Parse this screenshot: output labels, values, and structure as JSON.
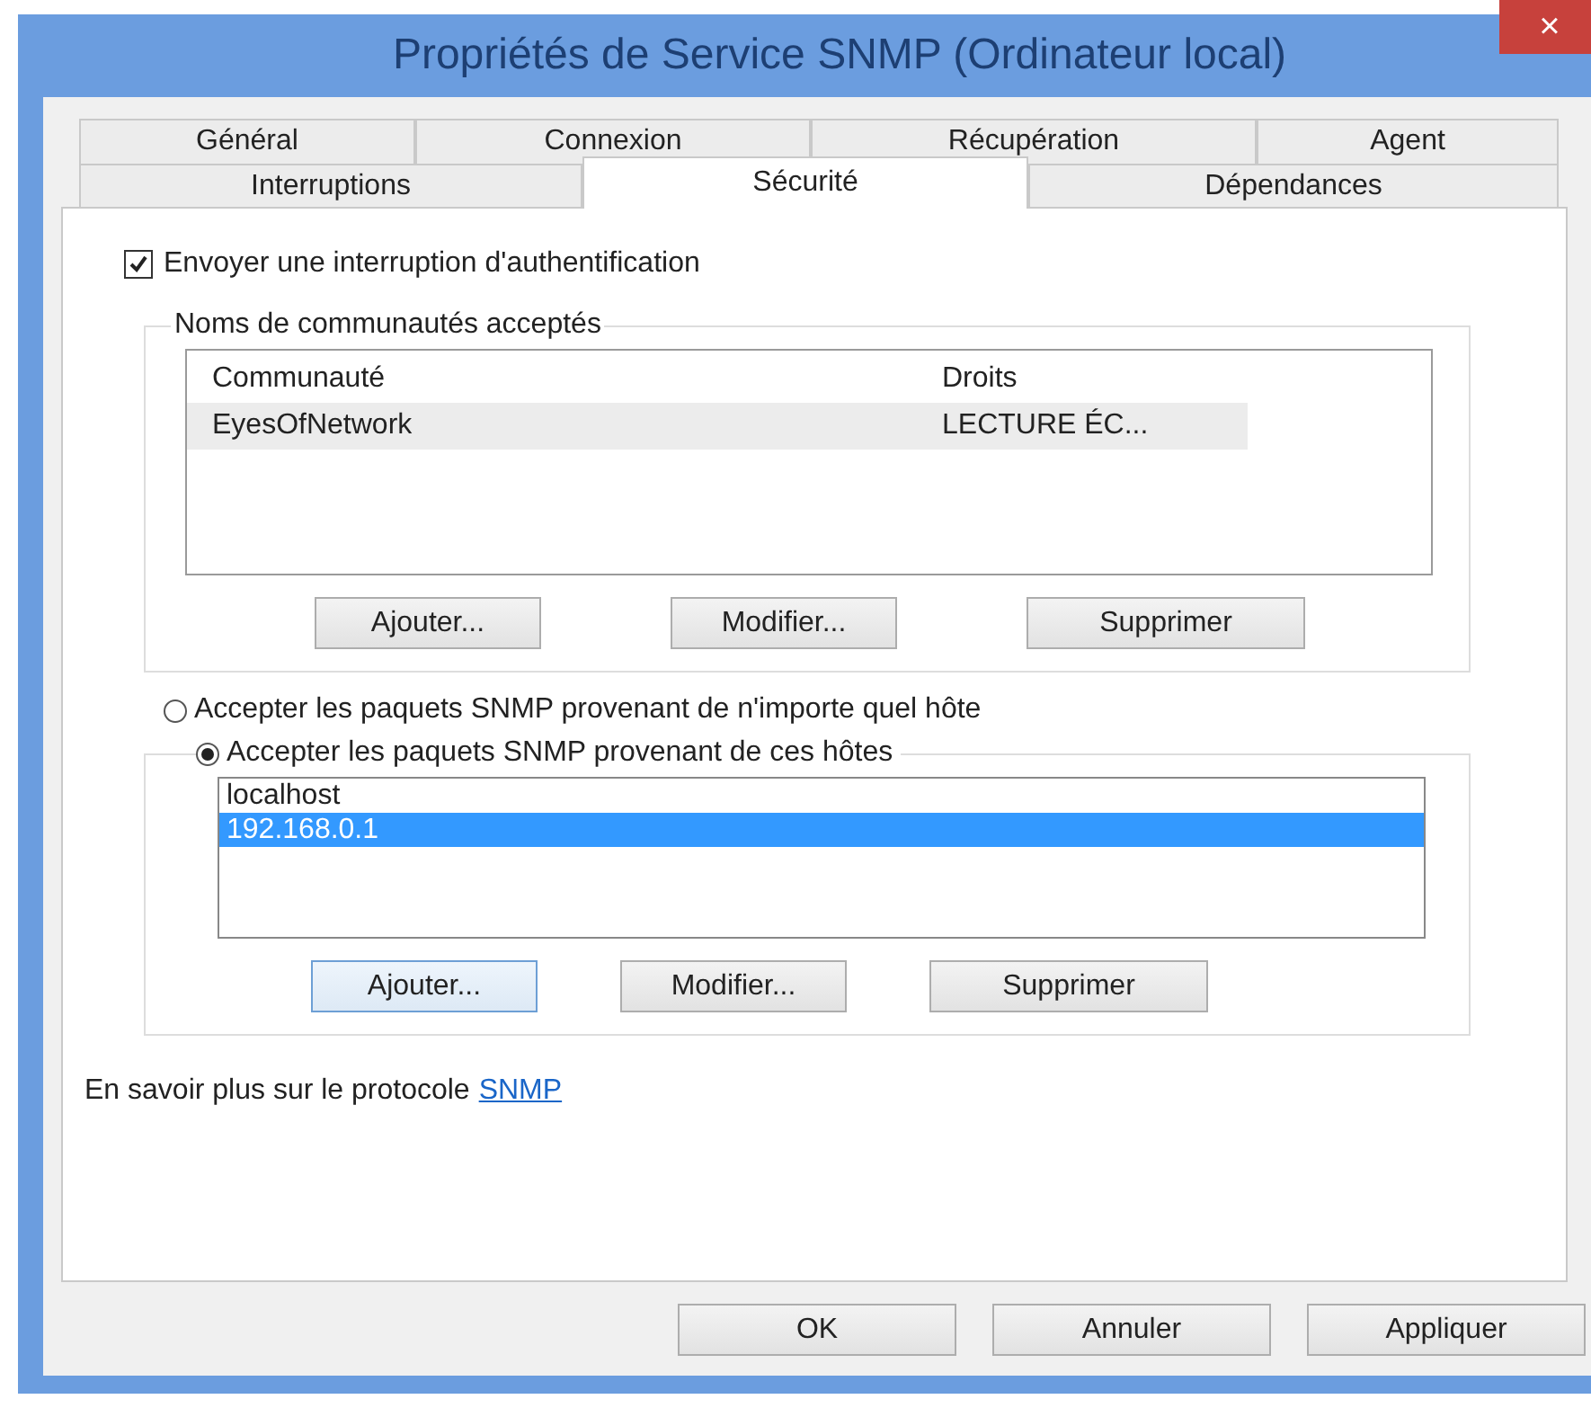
{
  "window": {
    "title": "Propriétés de Service SNMP (Ordinateur local)",
    "close": "×"
  },
  "tab_rows": [
    [
      {
        "label": "Général",
        "selected": false
      },
      {
        "label": "Connexion",
        "selected": false
      },
      {
        "label": "Récupération",
        "selected": false
      },
      {
        "label": "Agent",
        "selected": false
      }
    ],
    [
      {
        "label": "Interruptions",
        "selected": false
      },
      {
        "label": "Sécurité",
        "selected": true
      },
      {
        "label": "Dépendances",
        "selected": false
      }
    ]
  ],
  "auth_trap": {
    "label": "Envoyer une interruption d'authentification",
    "checked": true
  },
  "communities": {
    "title": "Noms de communautés acceptés",
    "columns": [
      "Communauté",
      "Droits"
    ],
    "rows": [
      {
        "cells": [
          "EyesOfNetwork",
          "LECTURE ÉC..."
        ],
        "selected": true
      }
    ],
    "buttons": [
      {
        "label": "Ajouter...",
        "focused": false
      },
      {
        "label": "Modifier...",
        "focused": false
      },
      {
        "label": "Supprimer",
        "focused": false
      }
    ]
  },
  "host_options": [
    {
      "label": "Accepter les paquets SNMP provenant de n'importe quel hôte",
      "selected": false
    },
    {
      "label": "Accepter les paquets SNMP provenant de ces hôtes",
      "selected": true
    }
  ],
  "hosts": {
    "items": [
      {
        "text": "localhost",
        "selected": false
      },
      {
        "text": "192.168.0.1",
        "selected": true
      }
    ],
    "buttons": [
      {
        "label": "Ajouter...",
        "focused": true
      },
      {
        "label": "Modifier...",
        "focused": false
      },
      {
        "label": "Supprimer",
        "focused": false
      }
    ]
  },
  "help": {
    "text": "En savoir plus sur le protocole",
    "link": "SNMP"
  },
  "buttons": [
    "OK",
    "Annuler",
    "Appliquer"
  ]
}
